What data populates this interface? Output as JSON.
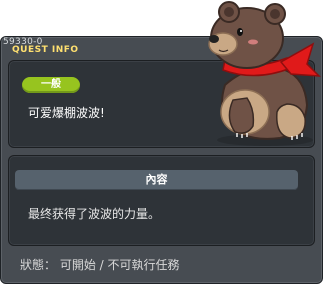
{
  "header": {
    "quest_id": "59330-0",
    "title": "QUEST INFO"
  },
  "quest": {
    "category": "一般",
    "name": "可爱爆棚波波!"
  },
  "content": {
    "header_label": "內容",
    "text": "最终获得了波波的力量。"
  },
  "status": {
    "text": "狀態： 可開始 / 不可執行任務"
  },
  "illustration": {
    "name": "brown-bear-with-red-scarf-icon"
  },
  "colors": {
    "badge_green": "#97c41f",
    "title_yellow": "#ffe070",
    "window_gray": "#474c52",
    "panel_dark": "#2e3338",
    "scarf_red": "#e01a1a"
  }
}
